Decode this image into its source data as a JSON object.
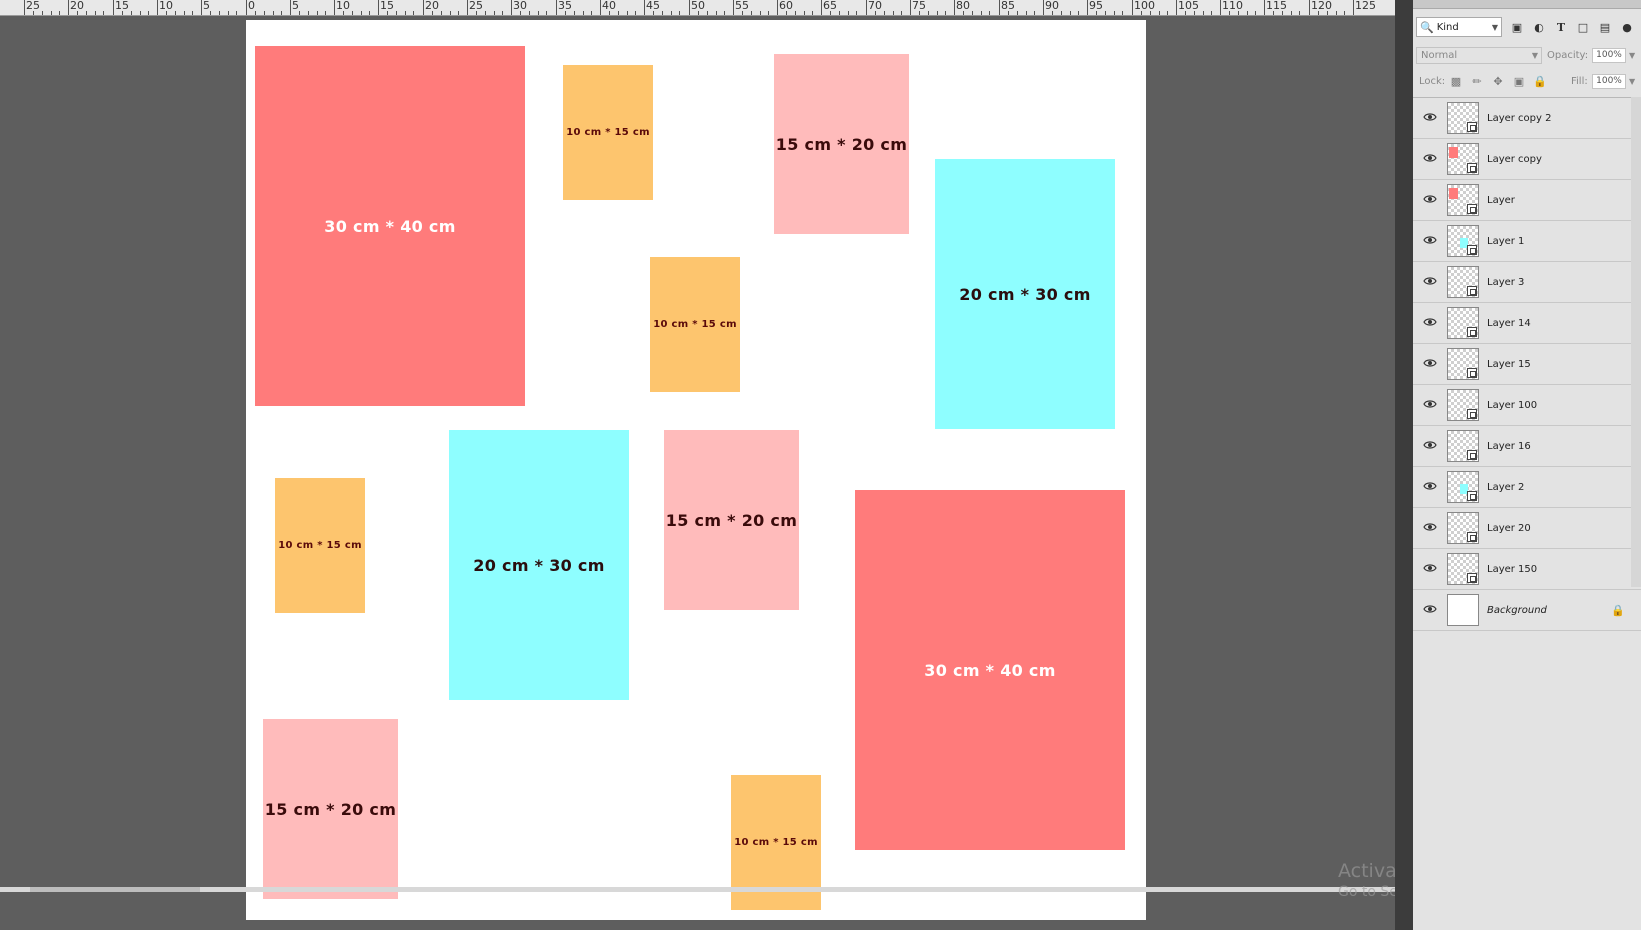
{
  "ruler": {
    "labels": [
      "25",
      "20",
      "15",
      "10",
      "5",
      "0",
      "5",
      "10",
      "15",
      "20",
      "25",
      "30",
      "35",
      "40",
      "45",
      "50",
      "55",
      "60",
      "65",
      "70",
      "75",
      "80",
      "85",
      "90",
      "95",
      "100",
      "105",
      "110",
      "115",
      "120",
      "125"
    ]
  },
  "canvas": {
    "frames": [
      {
        "label": "30 cm * 40 cm",
        "color": "red"
      },
      {
        "label": "10 cm * 15 cm",
        "color": "orange"
      },
      {
        "label": "15 cm * 20 cm",
        "color": "pink"
      },
      {
        "label": "10 cm * 15 cm",
        "color": "orange"
      },
      {
        "label": "20 cm * 30 cm",
        "color": "cyan"
      },
      {
        "label": "20 cm * 30 cm",
        "color": "cyan"
      },
      {
        "label": "15 cm * 20 cm",
        "color": "pink"
      },
      {
        "label": "10 cm * 15 cm",
        "color": "orange"
      },
      {
        "label": "30 cm * 40 cm",
        "color": "red"
      },
      {
        "label": "15 cm * 20 cm",
        "color": "pink"
      },
      {
        "label": "10 cm * 15 cm",
        "color": "orange"
      }
    ],
    "colors": {
      "red": "#ff7b7b",
      "pink": "#ffbbbb",
      "cyan": "#8efeff",
      "orange": "#fdc56e"
    }
  },
  "panel": {
    "filter_kind": "Kind",
    "filter_icons": [
      "image-filter-icon",
      "adjustment-filter-icon",
      "type-filter-icon",
      "shape-filter-icon",
      "smart-object-filter-icon"
    ],
    "blend_mode": "Normal",
    "opacity_label": "Opacity:",
    "opacity_value": "100%",
    "lock_label": "Lock:",
    "lock_icons": [
      "lock-transparent-icon",
      "lock-brush-icon",
      "lock-move-icon",
      "lock-artboard-icon",
      "lock-all-icon"
    ],
    "fill_label": "Fill:",
    "fill_value": "100%",
    "layers": [
      {
        "name": "Layer copy 2",
        "thumb": "checker",
        "italic": false
      },
      {
        "name": "Layer copy",
        "thumb": "red",
        "italic": false
      },
      {
        "name": "Layer",
        "thumb": "red",
        "italic": false
      },
      {
        "name": "Layer 1",
        "thumb": "cyan",
        "italic": false
      },
      {
        "name": "Layer 3",
        "thumb": "checker",
        "italic": false
      },
      {
        "name": "Layer 14",
        "thumb": "checker",
        "italic": false
      },
      {
        "name": "Layer 15",
        "thumb": "checker",
        "italic": false
      },
      {
        "name": "Layer 100",
        "thumb": "checker",
        "italic": false
      },
      {
        "name": "Layer 16",
        "thumb": "checker",
        "italic": false
      },
      {
        "name": "Layer 2",
        "thumb": "cyan",
        "italic": false
      },
      {
        "name": "Layer 20",
        "thumb": "checker",
        "italic": false
      },
      {
        "name": "Layer 150",
        "thumb": "checker",
        "italic": false
      },
      {
        "name": "Background",
        "thumb": "white",
        "italic": true,
        "locked": true
      }
    ]
  },
  "watermark": {
    "line1": "Activate Windows",
    "line2": "Go to Settings to activate Windows."
  }
}
